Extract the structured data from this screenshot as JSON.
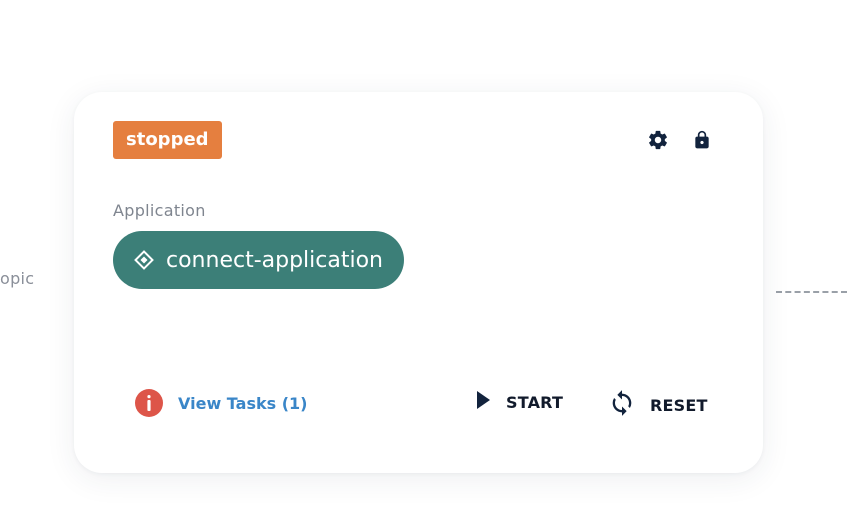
{
  "canvas": {
    "left_partial_label": "opic"
  },
  "card": {
    "status": "stopped",
    "status_color": "#e57f3f",
    "icons": [
      "gear-icon",
      "lock-icon"
    ],
    "section_label": "Application",
    "application": {
      "name": "connect-application",
      "icon": "diamond-icon",
      "color": "#3c7f78"
    },
    "footer": {
      "view_tasks_label": "View Tasks (1)",
      "alert_icon": "info-icon",
      "alert_color": "#dd5549",
      "start_label": "START",
      "reset_label": "RESET"
    }
  }
}
